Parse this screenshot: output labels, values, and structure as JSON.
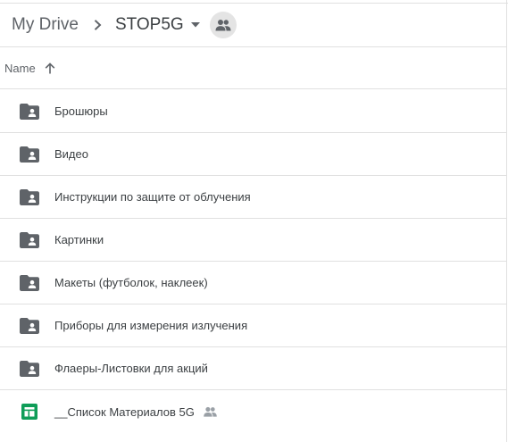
{
  "breadcrumb": {
    "root": "My Drive",
    "current": "STOP5G",
    "root_icon_sep": "chevron-right-icon",
    "caret_icon": "caret-down-icon",
    "shared_icon": "people-icon"
  },
  "column_header": {
    "name_label": "Name",
    "sort_icon": "arrow-up-icon",
    "sort_direction": "ascending"
  },
  "files": [
    {
      "name": "Брошюры",
      "type": "folder",
      "icon": "shared-folder-icon",
      "shared": false
    },
    {
      "name": "Видео",
      "type": "folder",
      "icon": "shared-folder-icon",
      "shared": false
    },
    {
      "name": "Инструкции по защите от облучения",
      "type": "folder",
      "icon": "shared-folder-icon",
      "shared": false
    },
    {
      "name": "Картинки",
      "type": "folder",
      "icon": "shared-folder-icon",
      "shared": false
    },
    {
      "name": "Макеты (футболок, наклеек)",
      "type": "folder",
      "icon": "shared-folder-icon",
      "shared": false
    },
    {
      "name": "Приборы для измерения излучения",
      "type": "folder",
      "icon": "shared-folder-icon",
      "shared": false
    },
    {
      "name": "Флаеры-Листовки для акций",
      "type": "folder",
      "icon": "shared-folder-icon",
      "shared": false
    },
    {
      "name": "__Список Материалов 5G",
      "type": "spreadsheet",
      "icon": "google-sheets-icon",
      "shared": true,
      "shared_icon": "people-icon"
    }
  ],
  "colors": {
    "folder_icon": "#5f6368",
    "sheets_icon": "#0f9d58",
    "divider": "#e0e0e0",
    "shared_button_bg": "#e4e4e4"
  }
}
